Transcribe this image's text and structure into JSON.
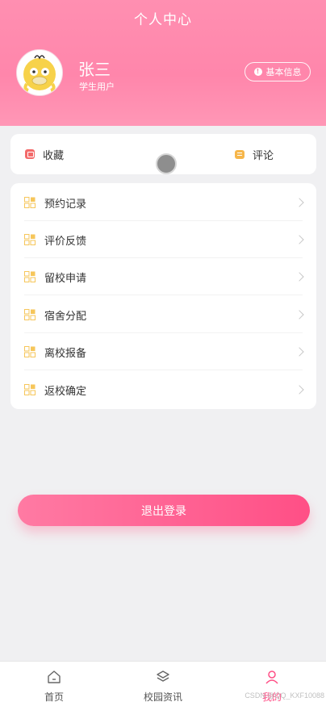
{
  "header": {
    "title": "个人中心",
    "user_name": "张三",
    "user_role": "学生用户",
    "info_button_label": "基本信息",
    "info_icon_glyph": "!"
  },
  "quick_links": [
    {
      "label": "收藏",
      "icon": "favorites-icon"
    },
    {
      "label": "评论",
      "icon": "comment-icon"
    }
  ],
  "menu": {
    "items": [
      {
        "label": "预约记录",
        "icon": "grid-icon"
      },
      {
        "label": "评价反馈",
        "icon": "grid-icon"
      },
      {
        "label": "留校申请",
        "icon": "grid-icon"
      },
      {
        "label": "宿舍分配",
        "icon": "grid-icon"
      },
      {
        "label": "离校报备",
        "icon": "grid-icon"
      },
      {
        "label": "返校确定",
        "icon": "grid-icon"
      }
    ]
  },
  "logout": {
    "label": "退出登录"
  },
  "tabbar": {
    "items": [
      {
        "label": "首页",
        "icon": "home-icon"
      },
      {
        "label": "校园资讯",
        "icon": "layers-icon"
      },
      {
        "label": "我的",
        "icon": "user-icon",
        "active": true
      }
    ]
  },
  "watermark": "CSDN @QQ_KXF10088",
  "colors": {
    "header_pink": "#ff86ab",
    "accent": "#ff4f86",
    "icon_yellow": "#f6c65a"
  }
}
